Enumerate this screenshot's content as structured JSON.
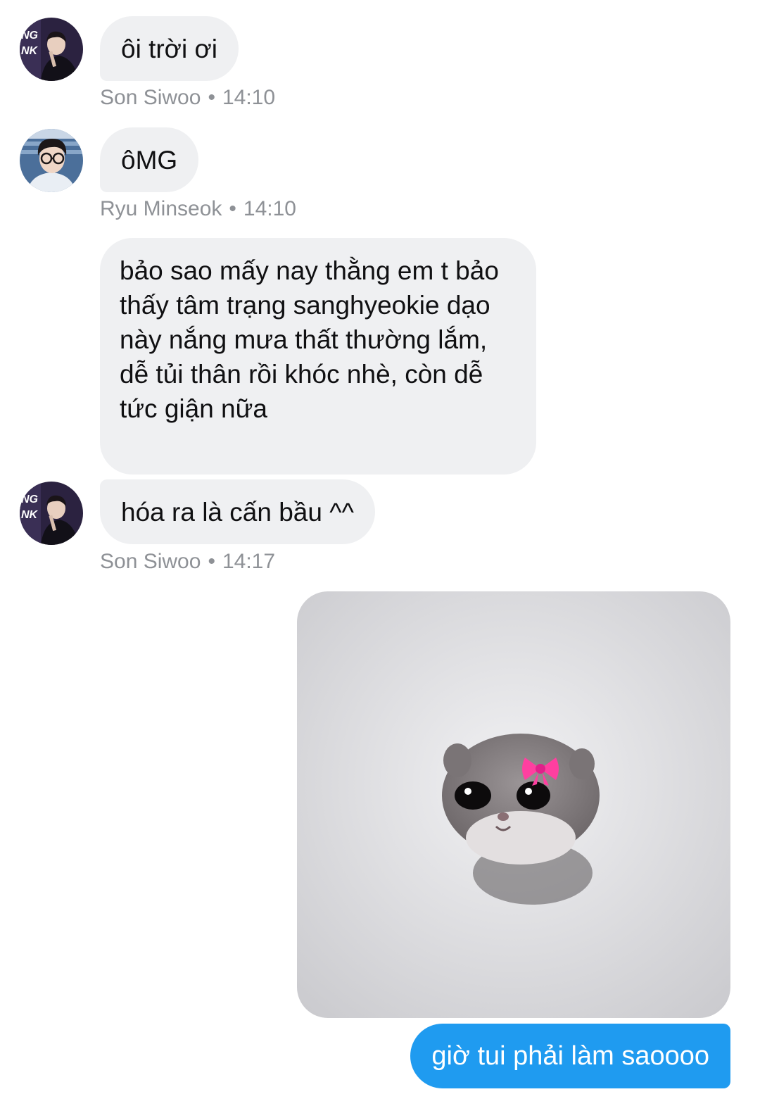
{
  "messages": [
    {
      "sender": "Son Siwoo",
      "time": "14:10",
      "text": "ôi trời ơi"
    },
    {
      "sender": "Ryu Minseok",
      "time": "14:10",
      "texts": [
        "ôMG",
        "bảo sao mấy nay thằng em t bảo thấy tâm trạng sanghyeokie dạo này nắng mưa thất thường lắm, dễ tủi thân rồi khóc nhè, còn dễ tức giận nữa"
      ]
    },
    {
      "sender": "Son Siwoo",
      "time": "14:17",
      "text": "hóa ra là cấn bầu ^^"
    }
  ],
  "meta_separator": "•",
  "sent": {
    "image": "sad-hamster-with-pink-bow-photo",
    "text": "giờ tui phải làm saoooo"
  },
  "colors": {
    "incoming_bubble": "#eff0f2",
    "outgoing_bubble": "#1f9bf0",
    "meta_text": "#8e9196"
  }
}
